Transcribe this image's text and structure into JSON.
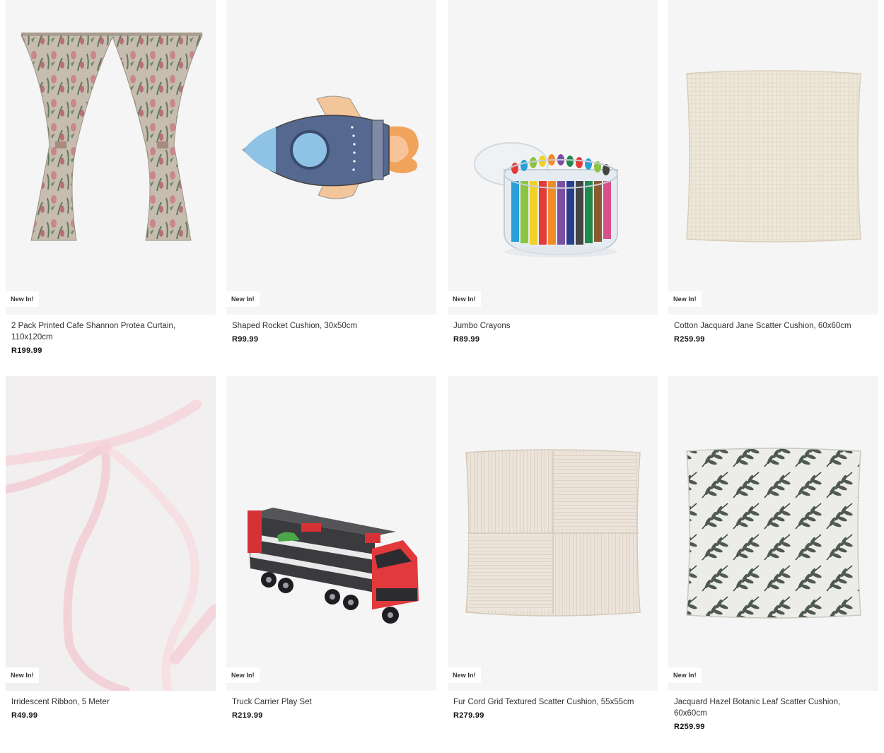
{
  "products": [
    {
      "name": "2 Pack Printed Cafe Shannon Protea Curtain, 110x120cm",
      "price": "R199.99",
      "badge": "New In!",
      "icon": "curtain-image"
    },
    {
      "name": "Shaped Rocket Cushion, 30x50cm",
      "price": "R99.99",
      "badge": "New In!",
      "icon": "rocket-cushion-image"
    },
    {
      "name": "Jumbo Crayons",
      "price": "R89.99",
      "badge": "New In!",
      "icon": "crayons-image"
    },
    {
      "name": "Cotton Jacquard Jane Scatter Cushion, 60x60cm",
      "price": "R259.99",
      "badge": "New In!",
      "icon": "cream-cushion-image"
    },
    {
      "name": "Irridescent Ribbon, 5 Meter",
      "price": "R49.99",
      "badge": "New In!",
      "icon": "ribbon-image"
    },
    {
      "name": "Truck Carrier Play Set",
      "price": "R219.99",
      "badge": "New In!",
      "icon": "truck-image"
    },
    {
      "name": "Fur Cord Grid Textured Scatter Cushion, 55x55cm",
      "price": "R279.99",
      "badge": "New In!",
      "icon": "cord-cushion-image"
    },
    {
      "name": "Jacquard Hazel Botanic Leaf Scatter Cushion, 60x60cm",
      "price": "R259.99",
      "badge": "New In!",
      "icon": "leaf-cushion-image"
    }
  ],
  "colors": {
    "image_bg": "#f5f5f5",
    "badge_bg": "#ffffff",
    "text": "#333333",
    "price": "#111111"
  }
}
